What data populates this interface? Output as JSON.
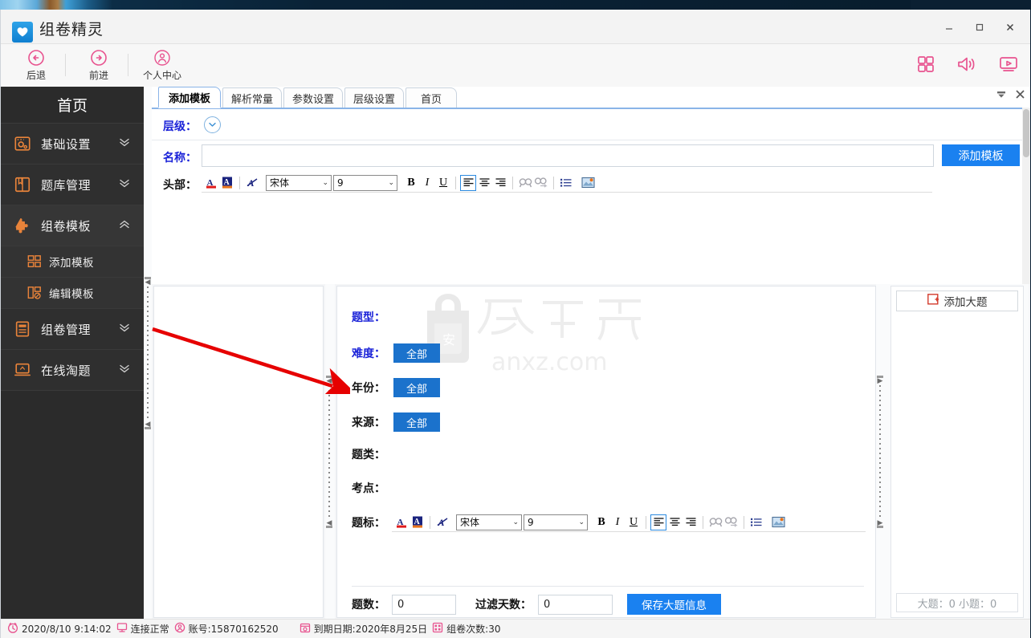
{
  "window": {
    "app_title": "组卷精灵",
    "logo_icon": "heart-logo-icon",
    "minimize": "–",
    "maximize": "□",
    "close": "✕"
  },
  "toolbar": {
    "items": [
      {
        "label": "后退",
        "icon": "back-arrow-icon"
      },
      {
        "label": "前进",
        "icon": "forward-arrow-icon"
      },
      {
        "label": "个人中心",
        "icon": "user-account-icon"
      }
    ],
    "right_icons": [
      {
        "name": "apps-grid-icon"
      },
      {
        "name": "speaker-icon"
      },
      {
        "name": "screen-video-icon"
      }
    ]
  },
  "sidebar": {
    "home_label": "首页",
    "items": [
      {
        "label": "基础设置",
        "icon": "settings-gear-icon",
        "chevron": "down",
        "expanded": false
      },
      {
        "label": "题库管理",
        "icon": "book-icon",
        "chevron": "down",
        "expanded": false
      },
      {
        "label": "组卷模板",
        "icon": "puzzle-icon",
        "chevron": "up",
        "expanded": true
      },
      {
        "label": "组卷管理",
        "icon": "document-icon",
        "chevron": "down",
        "expanded": false
      },
      {
        "label": "在线淘题",
        "icon": "laptop-icon",
        "chevron": "down",
        "expanded": false
      }
    ],
    "sub_items": [
      {
        "label": "添加模板",
        "icon": "add-template-icon"
      },
      {
        "label": "编辑模板",
        "icon": "edit-template-icon"
      }
    ]
  },
  "tabs": [
    {
      "label": "添加模板",
      "active": true
    },
    {
      "label": "解析常量",
      "active": false
    },
    {
      "label": "参数设置",
      "active": false
    },
    {
      "label": "层级设置",
      "active": false
    },
    {
      "label": "首页",
      "active": false
    }
  ],
  "tab_controls": {
    "dropdown_icon": "chevron-down-icon",
    "close_icon": "close-icon"
  },
  "top_form": {
    "level_label": "层级：",
    "level_button_icon": "chevron-down-circle-icon",
    "name_label": "名称：",
    "name_value": "",
    "name_placeholder": "",
    "add_template_button": "添加模板",
    "header_label": "头部："
  },
  "rich_toolbar": {
    "font_family": "宋体",
    "font_size": "9",
    "bold": "B",
    "italic": "I",
    "underline": "U",
    "buttons": [
      {
        "name": "text-color-icon"
      },
      {
        "name": "highlight-color-icon"
      },
      {
        "name": "clear-format-icon"
      },
      {
        "name": "align-left-icon"
      },
      {
        "name": "align-center-icon"
      },
      {
        "name": "align-right-icon"
      },
      {
        "name": "find-icon"
      },
      {
        "name": "find-replace-icon"
      },
      {
        "name": "bullet-list-icon"
      },
      {
        "name": "insert-image-icon"
      }
    ]
  },
  "center_form": {
    "fields": [
      {
        "label": "题型：",
        "value": "",
        "color": "blue",
        "has_button": false
      },
      {
        "label": "难度：",
        "value": "全部",
        "color": "blue",
        "has_button": true
      },
      {
        "label": "年份：",
        "value": "全部",
        "color": "dark",
        "has_button": true
      },
      {
        "label": "来源：",
        "value": "全部",
        "color": "dark",
        "has_button": true
      },
      {
        "label": "题类：",
        "value": "",
        "color": "dark",
        "has_button": false
      },
      {
        "label": "考点：",
        "value": "",
        "color": "dark",
        "has_button": false
      }
    ],
    "title_label": "题标：",
    "count_label": "题数：",
    "count_value": "0",
    "filter_days_label": "过滤天数：",
    "filter_days_value": "0",
    "save_button": "保存大题信息"
  },
  "right_pane": {
    "add_big_question": "添加大题",
    "add_icon": "add-box-icon",
    "count_text": "大题：0 小题：0"
  },
  "watermark": {
    "brand_char": "安",
    "text_line": "安下载",
    "domain": "anxz.com"
  },
  "statusbar": {
    "items": [
      {
        "icon": "clock-icon",
        "text": "2020/8/10 9:14:02"
      },
      {
        "icon": "monitor-icon",
        "text": "连接正常"
      },
      {
        "icon": "user-icon",
        "text": "账号:15870162520"
      },
      {
        "icon": "calendar-icon",
        "text": "到期日期:2020年8月25日"
      },
      {
        "icon": "grid-icon",
        "text": "组卷次数:30"
      }
    ]
  },
  "colors": {
    "accent_blue": "#1a81f0",
    "button_blue": "#1b72cc",
    "sidebar_bg": "#2b2b2b",
    "sidebar_icon": "#e8833a",
    "status_pink": "#e8538f",
    "label_blue": "#1b23d8",
    "annotation_red": "#e60000"
  }
}
